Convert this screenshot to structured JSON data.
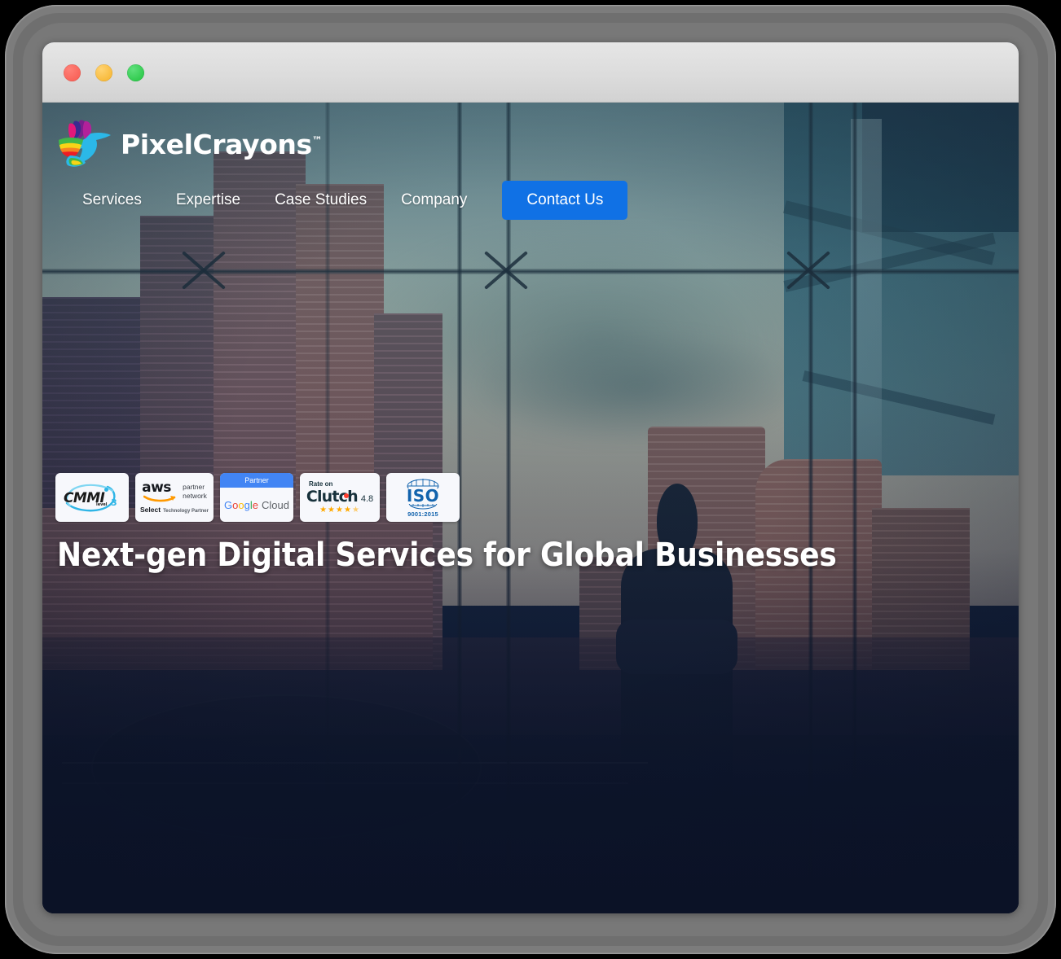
{
  "window": {
    "controls": [
      {
        "name": "close",
        "color": "#f7584e"
      },
      {
        "name": "minimize",
        "color": "#f5b128"
      },
      {
        "name": "maximize",
        "color": "#1fc23c"
      }
    ]
  },
  "site": {
    "brand": {
      "name": "PixelCrayons",
      "trademark": "™",
      "logo_icon": "hummingbird-logo"
    },
    "nav": {
      "items": [
        {
          "label": "Services"
        },
        {
          "label": "Expertise"
        },
        {
          "label": "Case Studies"
        },
        {
          "label": "Company"
        }
      ],
      "cta": {
        "label": "Contact Us",
        "color": "#1071e5"
      }
    }
  },
  "hero": {
    "title": "Next-gen Digital Services for Global Businesses",
    "badges": [
      {
        "id": "cmmi",
        "name": "CMMI",
        "level_label": "level",
        "level_value": "3",
        "accent": "#2fb5e6"
      },
      {
        "id": "aws",
        "brand": "aws",
        "line1": "partner",
        "line2": "network",
        "tier": "Select",
        "tier_sub": "Technology Partner",
        "accent": "#ff9900"
      },
      {
        "id": "google-cloud",
        "header": "Partner",
        "word_g1": "G",
        "word_o1": "o",
        "word_o2": "o",
        "word_g2": "g",
        "word_l": "l",
        "word_e": "e",
        "cloud": "Cloud",
        "accent": "#4285f4"
      },
      {
        "id": "clutch",
        "rate_on": "Rate on",
        "name": "Clutch",
        "score": "4.8",
        "stars": "★★★★",
        "half_star": "★",
        "accent": "#ffaa00"
      },
      {
        "id": "iso",
        "name": "ISO",
        "standard": "9001:2015",
        "accent": "#1263ad"
      }
    ]
  },
  "colors": {
    "cta_blue": "#1071e5",
    "page_dark": "#101d38",
    "titlebar": "#dcdcdc",
    "bezel": "#7c7c7c"
  }
}
